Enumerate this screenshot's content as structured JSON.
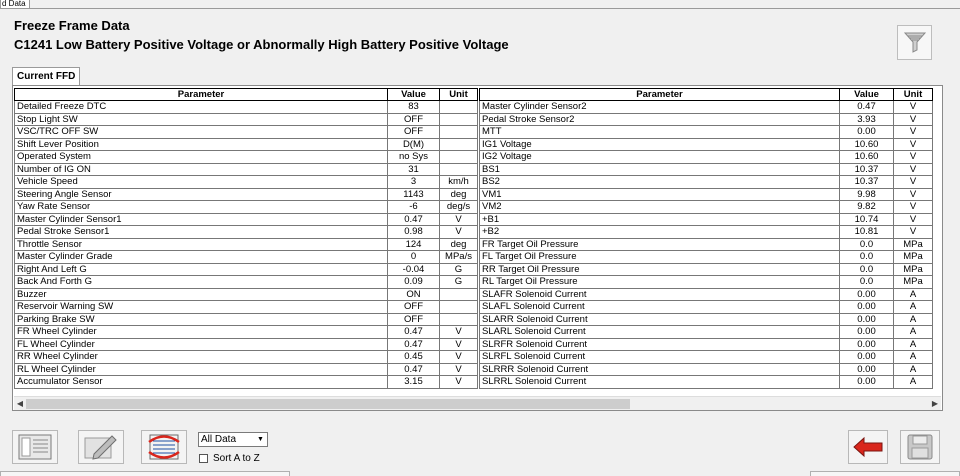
{
  "top_tab": "d Data",
  "header": {
    "title": "Freeze Frame Data",
    "subtitle": "C1241 Low Battery Positive Voltage or Abnormally High Battery Positive Voltage"
  },
  "tab": "Current FFD",
  "columns": {
    "parameter": "Parameter",
    "value": "Value",
    "unit": "Unit"
  },
  "left_rows": [
    {
      "p": "Detailed Freeze DTC",
      "v": "83",
      "u": ""
    },
    {
      "p": "Stop Light SW",
      "v": "OFF",
      "u": ""
    },
    {
      "p": "VSC/TRC OFF SW",
      "v": "OFF",
      "u": ""
    },
    {
      "p": "Shift Lever Position",
      "v": "D(M)",
      "u": ""
    },
    {
      "p": "Operated System",
      "v": "no Sys",
      "u": ""
    },
    {
      "p": "Number of IG ON",
      "v": "31",
      "u": ""
    },
    {
      "p": "Vehicle Speed",
      "v": "3",
      "u": "km/h"
    },
    {
      "p": "Steering Angle Sensor",
      "v": "1143",
      "u": "deg"
    },
    {
      "p": "Yaw Rate Sensor",
      "v": "-6",
      "u": "deg/s"
    },
    {
      "p": "Master Cylinder Sensor1",
      "v": "0.47",
      "u": "V"
    },
    {
      "p": "Pedal Stroke Sensor1",
      "v": "0.98",
      "u": "V"
    },
    {
      "p": "Throttle Sensor",
      "v": "124",
      "u": "deg"
    },
    {
      "p": "Master Cylinder Grade",
      "v": "0",
      "u": "MPa/s"
    },
    {
      "p": "Right And Left G",
      "v": "-0.04",
      "u": "G"
    },
    {
      "p": "Back And Forth G",
      "v": "0.09",
      "u": "G"
    },
    {
      "p": "Buzzer",
      "v": "ON",
      "u": ""
    },
    {
      "p": "Reservoir Warning SW",
      "v": "OFF",
      "u": ""
    },
    {
      "p": "Parking Brake SW",
      "v": "OFF",
      "u": ""
    },
    {
      "p": "FR Wheel Cylinder",
      "v": "0.47",
      "u": "V"
    },
    {
      "p": "FL Wheel Cylinder",
      "v": "0.47",
      "u": "V"
    },
    {
      "p": "RR Wheel Cylinder",
      "v": "0.45",
      "u": "V"
    },
    {
      "p": "RL Wheel Cylinder",
      "v": "0.47",
      "u": "V"
    },
    {
      "p": "Accumulator Sensor",
      "v": "3.15",
      "u": "V"
    }
  ],
  "right_rows": [
    {
      "p": "Master Cylinder Sensor2",
      "v": "0.47",
      "u": "V"
    },
    {
      "p": "Pedal Stroke Sensor2",
      "v": "3.93",
      "u": "V"
    },
    {
      "p": "MTT",
      "v": "0.00",
      "u": "V"
    },
    {
      "p": "IG1 Voltage",
      "v": "10.60",
      "u": "V"
    },
    {
      "p": "IG2 Voltage",
      "v": "10.60",
      "u": "V"
    },
    {
      "p": "BS1",
      "v": "10.37",
      "u": "V"
    },
    {
      "p": "BS2",
      "v": "10.37",
      "u": "V"
    },
    {
      "p": "VM1",
      "v": "9.98",
      "u": "V"
    },
    {
      "p": "VM2",
      "v": "9.82",
      "u": "V"
    },
    {
      "p": "+B1",
      "v": "10.74",
      "u": "V"
    },
    {
      "p": "+B2",
      "v": "10.81",
      "u": "V"
    },
    {
      "p": "FR Target Oil Pressure",
      "v": "0.0",
      "u": "MPa"
    },
    {
      "p": "FL Target Oil Pressure",
      "v": "0.0",
      "u": "MPa"
    },
    {
      "p": "RR Target Oil Pressure",
      "v": "0.0",
      "u": "MPa"
    },
    {
      "p": "RL Target Oil Pressure",
      "v": "0.0",
      "u": "MPa"
    },
    {
      "p": "SLAFR Solenoid Current",
      "v": "0.00",
      "u": "A"
    },
    {
      "p": "SLAFL Solenoid Current",
      "v": "0.00",
      "u": "A"
    },
    {
      "p": "SLARR Solenoid Current",
      "v": "0.00",
      "u": "A"
    },
    {
      "p": "SLARL Solenoid Current",
      "v": "0.00",
      "u": "A"
    },
    {
      "p": "SLRFR Solenoid Current",
      "v": "0.00",
      "u": "A"
    },
    {
      "p": "SLRFL Solenoid Current",
      "v": "0.00",
      "u": "A"
    },
    {
      "p": "SLRRR Solenoid Current",
      "v": "0.00",
      "u": "A"
    },
    {
      "p": "SLRRL Solenoid Current",
      "v": "0.00",
      "u": "A"
    }
  ],
  "footer": {
    "select_value": "All Data",
    "sort_label": "Sort A to Z"
  },
  "colors": {
    "back_arrow": "#d9261c",
    "accent_red": "#d9261c",
    "accent_blue": "#1e4fa3"
  }
}
